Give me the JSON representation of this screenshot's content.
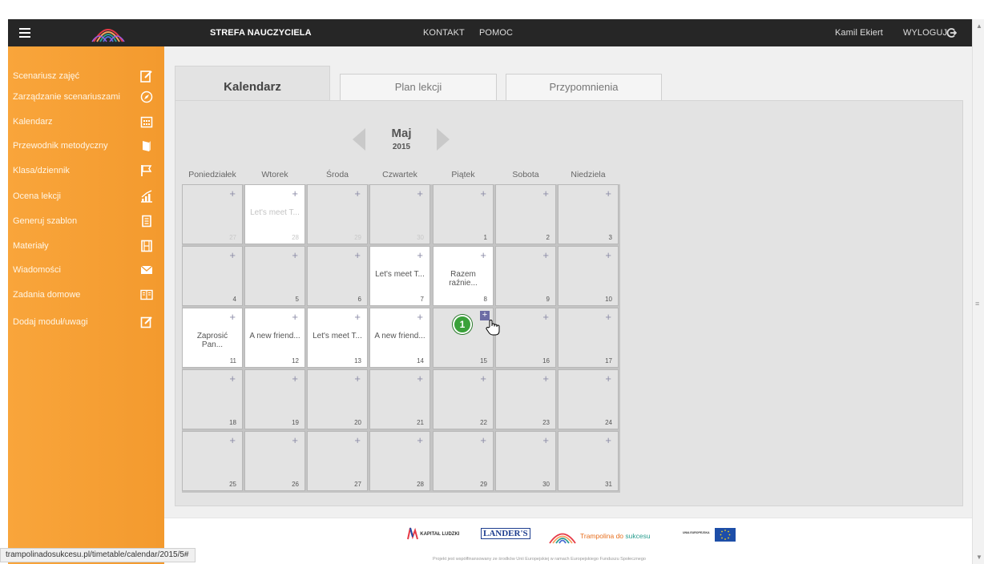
{
  "topbar": {
    "zone": "STREFA NAUCZYCIELA",
    "contact": "KONTAKT",
    "help": "POMOC",
    "user": "Kamil Ekiert",
    "logout": "WYLOGUJ"
  },
  "sidebar": {
    "items": [
      {
        "label": "Scenariusz zajęć",
        "icon": "pencil-note-icon"
      },
      {
        "label": "Zarządzanie scenariuszami",
        "icon": "compass-icon"
      },
      {
        "label": "Kalendarz",
        "icon": "calendar-icon"
      },
      {
        "label": "Przewodnik metodyczny",
        "icon": "book-icon"
      },
      {
        "label": "Klasa/dziennik",
        "icon": "flag-icon"
      },
      {
        "label": "Ocena lekcji",
        "icon": "chart-icon"
      },
      {
        "label": "Generuj szablon",
        "icon": "document-icon"
      },
      {
        "label": "Materiały",
        "icon": "film-icon"
      },
      {
        "label": "Wiadomości",
        "icon": "envelope-icon"
      },
      {
        "label": "Zadania domowe",
        "icon": "open-book-icon"
      },
      {
        "label": "Dodaj moduł/uwagi",
        "icon": "note-icon"
      }
    ]
  },
  "tabs": [
    {
      "label": "Kalendarz",
      "active": true
    },
    {
      "label": "Plan lekcji",
      "active": false
    },
    {
      "label": "Przypomnienia",
      "active": false
    }
  ],
  "calendar": {
    "month": "Maj",
    "year": "2015",
    "weekdays": [
      "Poniedziałek",
      "Wtorek",
      "Środa",
      "Czwartek",
      "Piątek",
      "Sobota",
      "Niedziela"
    ],
    "weeks": [
      [
        {
          "day": "27",
          "other": true,
          "event": ""
        },
        {
          "day": "28",
          "other": true,
          "event": "Let's meet T..."
        },
        {
          "day": "29",
          "other": true,
          "event": ""
        },
        {
          "day": "30",
          "other": true,
          "event": ""
        },
        {
          "day": "1",
          "other": false,
          "event": ""
        },
        {
          "day": "2",
          "other": false,
          "event": ""
        },
        {
          "day": "3",
          "other": false,
          "event": ""
        }
      ],
      [
        {
          "day": "4",
          "other": false,
          "event": ""
        },
        {
          "day": "5",
          "other": false,
          "event": ""
        },
        {
          "day": "6",
          "other": false,
          "event": ""
        },
        {
          "day": "7",
          "other": false,
          "event": "Let's meet T..."
        },
        {
          "day": "8",
          "other": false,
          "event": "Razem raźnie..."
        },
        {
          "day": "9",
          "other": false,
          "event": ""
        },
        {
          "day": "10",
          "other": false,
          "event": ""
        }
      ],
      [
        {
          "day": "11",
          "other": false,
          "event": "Zaprosić Pan..."
        },
        {
          "day": "12",
          "other": false,
          "event": "A new friend..."
        },
        {
          "day": "13",
          "other": false,
          "event": "Let's meet T..."
        },
        {
          "day": "14",
          "other": false,
          "event": "A new friend..."
        },
        {
          "day": "15",
          "other": false,
          "event": "",
          "highlight": true
        },
        {
          "day": "16",
          "other": false,
          "event": ""
        },
        {
          "day": "17",
          "other": false,
          "event": ""
        }
      ],
      [
        {
          "day": "18",
          "other": false,
          "event": ""
        },
        {
          "day": "19",
          "other": false,
          "event": ""
        },
        {
          "day": "20",
          "other": false,
          "event": ""
        },
        {
          "day": "21",
          "other": false,
          "event": ""
        },
        {
          "day": "22",
          "other": false,
          "event": ""
        },
        {
          "day": "23",
          "other": false,
          "event": ""
        },
        {
          "day": "24",
          "other": false,
          "event": ""
        }
      ],
      [
        {
          "day": "25",
          "other": false,
          "event": ""
        },
        {
          "day": "26",
          "other": false,
          "event": ""
        },
        {
          "day": "27",
          "other": false,
          "event": ""
        },
        {
          "day": "28",
          "other": false,
          "event": ""
        },
        {
          "day": "29",
          "other": false,
          "event": ""
        },
        {
          "day": "30",
          "other": false,
          "event": ""
        },
        {
          "day": "31",
          "other": false,
          "event": ""
        }
      ]
    ],
    "plus": "+"
  },
  "annotation": {
    "step": "1"
  },
  "footer": {
    "kapital": "KAPITAŁ LUDZKI",
    "landers": "LANDER'S",
    "trampolina_a": "Trampolina do",
    "trampolina_b": "sukcesu",
    "ue": "UNIA EUROPEJSKA",
    "note": "Projekt jest współfinansowany ze środków Unii Europejskiej w ramach Europejskiego Funduszu Społecznego"
  },
  "status_url": "trampolinadosukcesu.pl/timetable/calendar/2015/5#",
  "colors": {
    "topbar": "#262626",
    "sidebar": "#f9a53b",
    "panel": "#e3e3e3",
    "badge": "#3aa13a",
    "plus_accent": "#6c6ca5"
  }
}
